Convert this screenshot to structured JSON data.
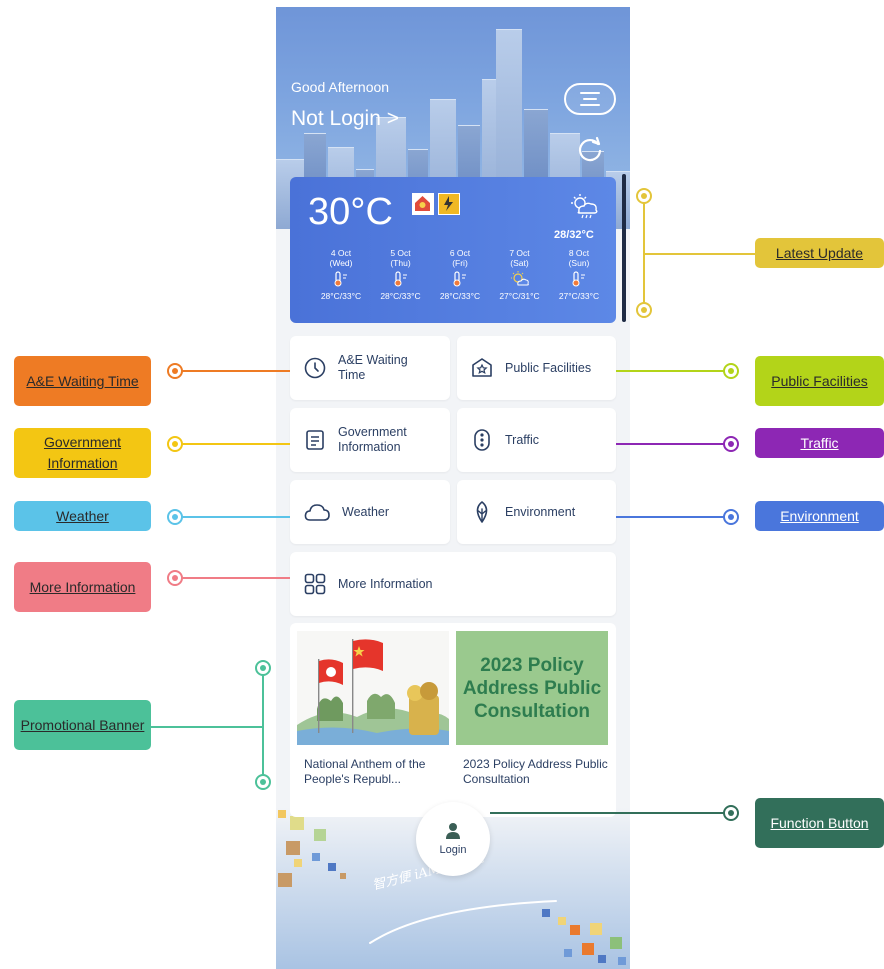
{
  "header": {
    "greeting": "Good Afternoon",
    "login_link": "Not Login >"
  },
  "weather": {
    "current_temp": "30°C",
    "today_range": "28/32°C",
    "forecast": [
      {
        "date": "4 Oct",
        "day": "(Wed)",
        "range": "28°C/33°C",
        "icon": "hot-icon"
      },
      {
        "date": "5 Oct",
        "day": "(Thu)",
        "range": "28°C/33°C",
        "icon": "hot-icon"
      },
      {
        "date": "6 Oct",
        "day": "(Fri)",
        "range": "28°C/33°C",
        "icon": "hot-icon"
      },
      {
        "date": "7 Oct",
        "day": "(Sat)",
        "range": "27°C/31°C",
        "icon": "sunny-cloud-icon"
      },
      {
        "date": "8 Oct",
        "day": "(Sun)",
        "range": "27°C/33°C",
        "icon": "hot-icon"
      }
    ]
  },
  "tiles": {
    "ae_waiting": "A&E Waiting Time",
    "public_facilities": "Public Facilities",
    "government_info": "Government Information",
    "traffic": "Traffic",
    "weather": "Weather",
    "environment": "Environment",
    "more_info": "More Information"
  },
  "banners": [
    {
      "caption": "National Anthem of the People's Republ..."
    },
    {
      "caption": "2023 Policy Address Public Consultation",
      "image_text": "2023 Policy Address Public Consultation"
    }
  ],
  "login_button": "Login",
  "brand": "智方便 iAM Smart",
  "annotations": {
    "latest_update": "Latest Update",
    "ae_waiting_time": "A&E Waiting Time",
    "public_facilities": "Public Facilities",
    "government_information": "Government Information",
    "traffic": "Traffic",
    "weather": "Weather",
    "environment": "Environment",
    "more_information": "More Information",
    "promotional_banner": "Promotional Banner",
    "function_button": "Function Button"
  },
  "colors": {
    "ae": "#ee7b24",
    "gov": "#f3c613",
    "weather": "#5bc3e8",
    "more": "#f07c86",
    "promo": "#4cc199",
    "latest": "#e3c53a",
    "facilities": "#b3d419",
    "traffic": "#8d27b4",
    "environment": "#4a76dc",
    "function": "#326f5a"
  }
}
